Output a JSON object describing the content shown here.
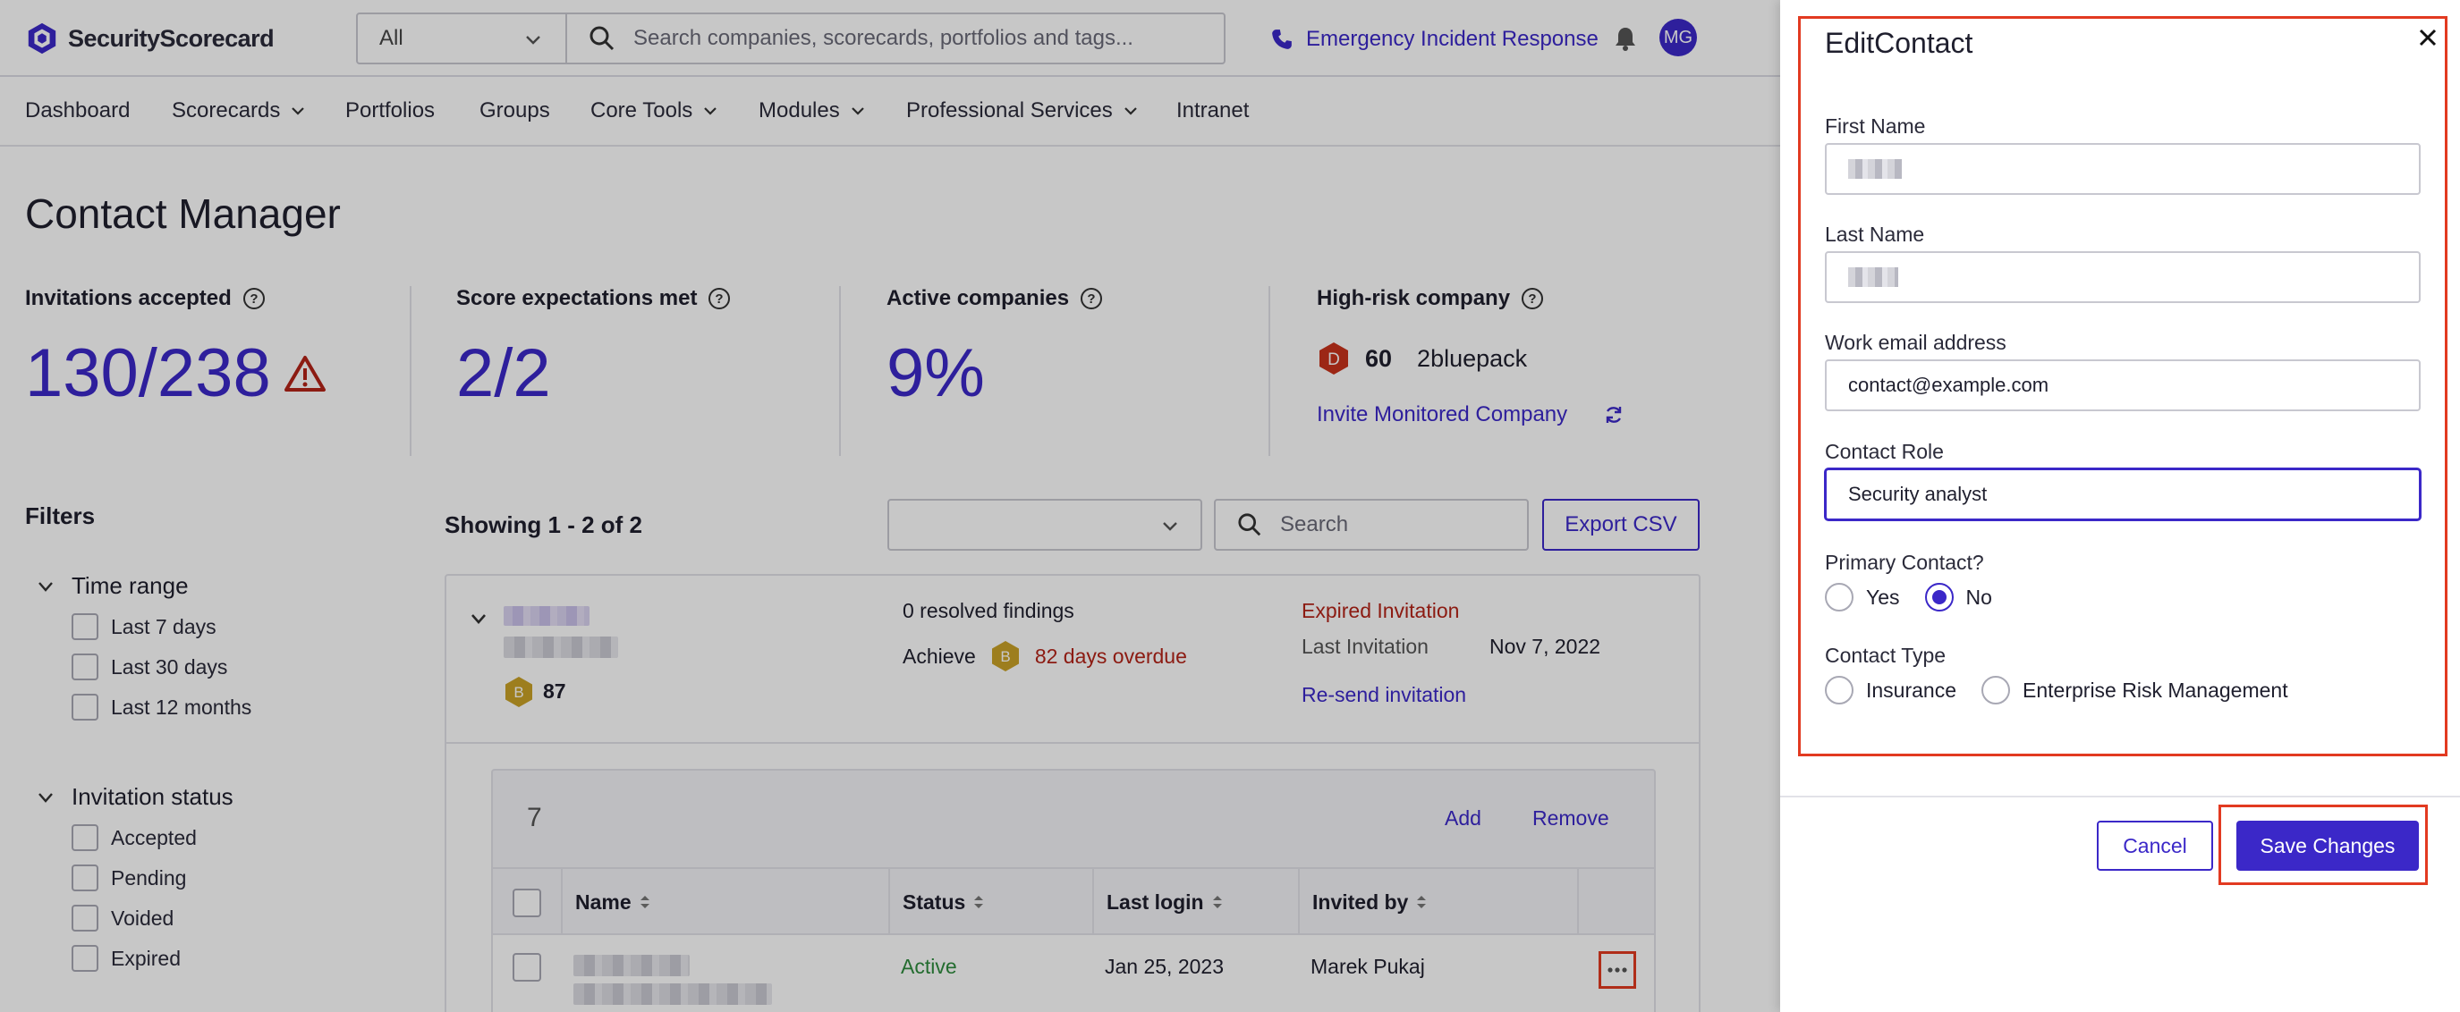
{
  "app": {
    "brand": "SecurityScorecard",
    "scope_select": "All",
    "search_placeholder": "Search companies, scorecards, portfolios and tags...",
    "emergency_link": "Emergency Incident Response",
    "avatar_initials": "MG"
  },
  "nav": {
    "items": [
      {
        "label": "Dashboard"
      },
      {
        "label": "Scorecards"
      },
      {
        "label": "Portfolios"
      },
      {
        "label": "Groups"
      },
      {
        "label": "Core Tools"
      },
      {
        "label": "Modules"
      },
      {
        "label": "Professional Services"
      },
      {
        "label": "Intranet"
      }
    ]
  },
  "page": {
    "title": "Contact Manager",
    "metrics": {
      "invitations_label": "Invitations accepted",
      "invitations_value": "130/238",
      "score_label": "Score expectations met",
      "score_value": "2/2",
      "active_label": "Active companies",
      "active_value": "9%",
      "highrisk_label": "High-risk company",
      "highrisk_grade": "D",
      "highrisk_score": "60",
      "highrisk_name": "2bluepack",
      "invite_link": "Invite Monitored Company"
    }
  },
  "filters": {
    "title": "Filters",
    "time_range": {
      "title": "Time range",
      "options": [
        "Last 7 days",
        "Last 30 days",
        "Last 12 months"
      ]
    },
    "invitation_status": {
      "title": "Invitation status",
      "options": [
        "Accepted",
        "Pending",
        "Voided",
        "Expired"
      ]
    }
  },
  "list": {
    "showing": "Showing 1 - 2 of 2",
    "search_placeholder": "Search",
    "export_label": "Export CSV",
    "company": {
      "grade": "B",
      "score": "87",
      "findings": "0 resolved findings",
      "achieve_label": "Achieve",
      "achieve_grade": "B",
      "overdue": "82 days overdue",
      "invitation_status": "Expired Invitation",
      "last_invitation_label": "Last Invitation",
      "last_invitation_date": "Nov 7, 2022",
      "resend": "Re-send invitation"
    },
    "contacts": {
      "count": "7",
      "add": "Add",
      "remove": "Remove",
      "columns": [
        "Name",
        "Status",
        "Last login",
        "Invited by"
      ],
      "rows": [
        {
          "status": "Active",
          "last_login": "Jan 25, 2023",
          "invited_by": "Marek Pukaj"
        }
      ]
    }
  },
  "drawer": {
    "title": "EditContact",
    "first_name_label": "First Name",
    "last_name_label": "Last Name",
    "email_label": "Work email address",
    "email_value": "contact@example.com",
    "role_label": "Contact Role",
    "role_value": "Security analyst",
    "primary_label": "Primary Contact?",
    "primary_yes": "Yes",
    "primary_no": "No",
    "type_label": "Contact Type",
    "type_insurance": "Insurance",
    "type_erm": "Enterprise Risk Management",
    "cancel": "Cancel",
    "save": "Save Changes"
  },
  "colors": {
    "accent": "#3b28c8",
    "danger": "#b42318",
    "success": "#2e8b3d",
    "highlight": "#e23a21",
    "grade_b": "#c9a227",
    "grade_d": "#c8321c"
  }
}
